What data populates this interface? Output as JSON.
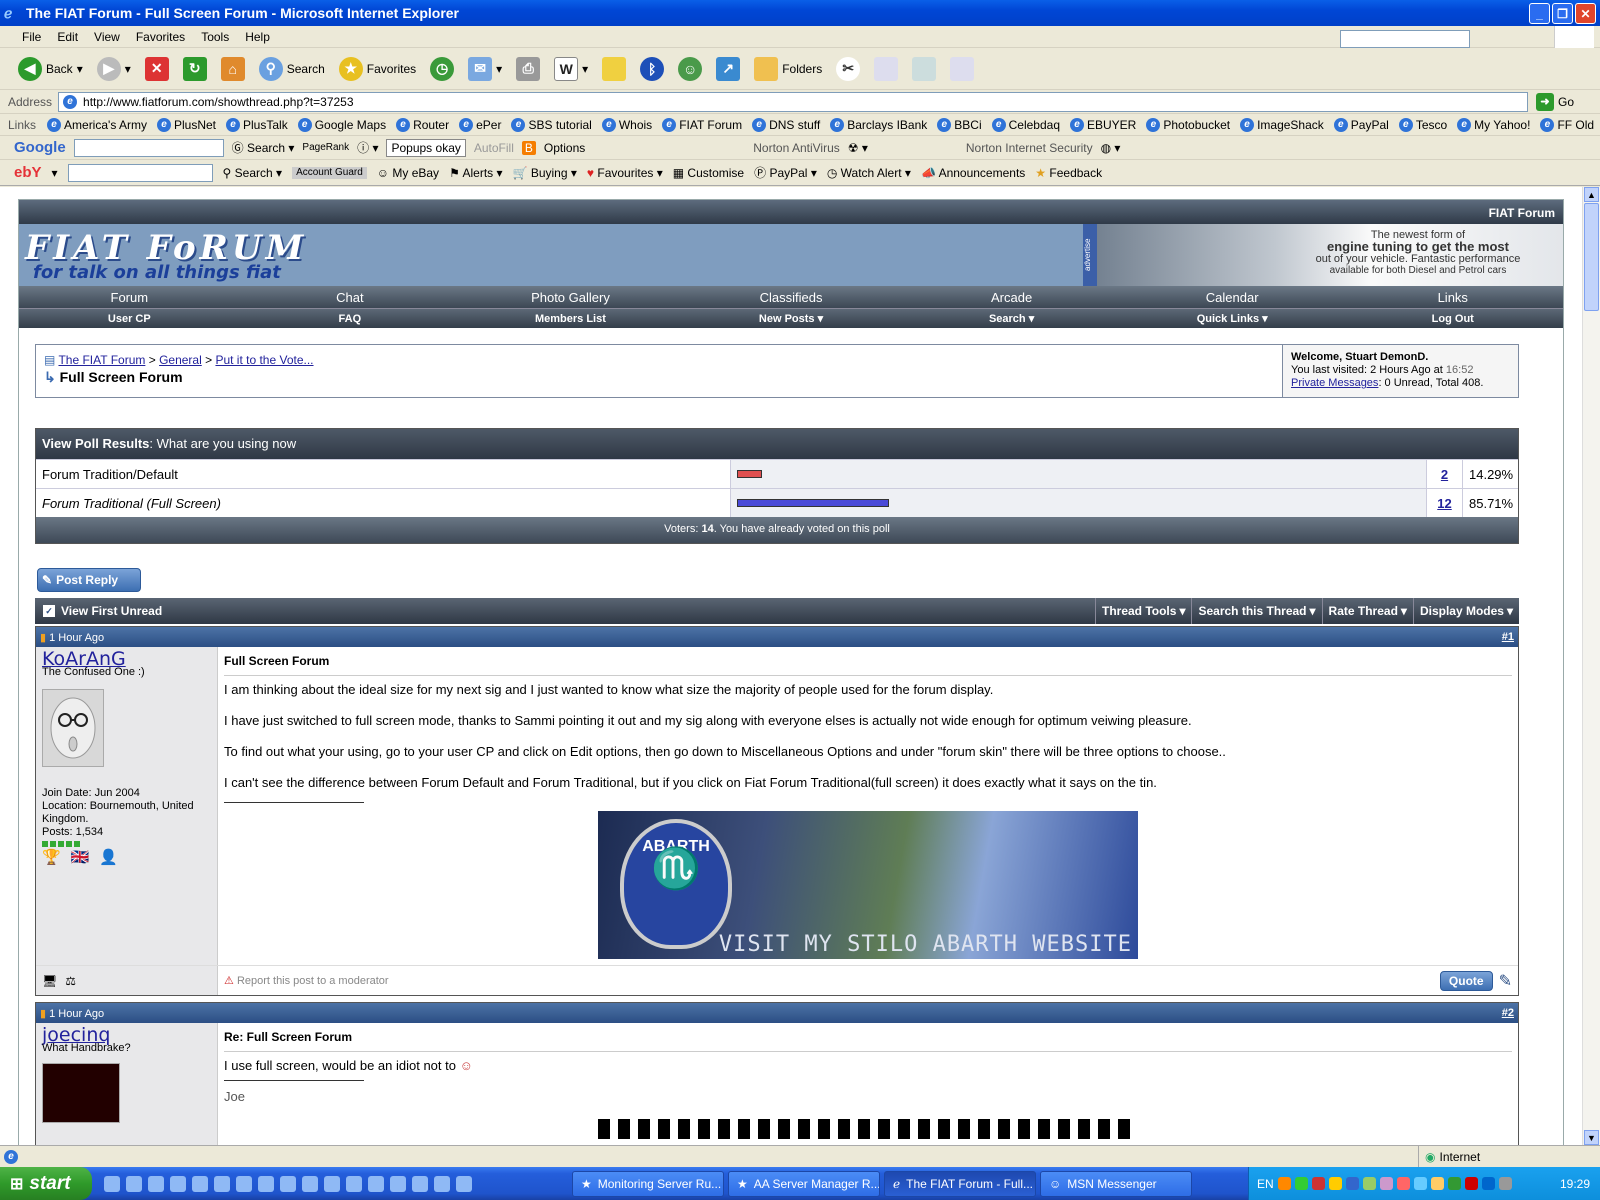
{
  "window": {
    "title": "The FIAT Forum - Full Screen Forum - Microsoft Internet Explorer"
  },
  "menu": [
    "File",
    "Edit",
    "View",
    "Favorites",
    "Tools",
    "Help"
  ],
  "toolbar": {
    "back": "Back",
    "search": "Search",
    "favorites": "Favorites",
    "folders": "Folders"
  },
  "address": {
    "label": "Address",
    "url": "http://www.fiatforum.com/showthread.php?t=37253",
    "go": "Go"
  },
  "links": {
    "label": "Links",
    "items": [
      "America's Army",
      "PlusNet",
      "PlusTalk",
      "Google Maps",
      "Router",
      "ePer",
      "SBS tutorial",
      "Whois",
      "FIAT Forum",
      "DNS stuff",
      "Barclays IBank",
      "BBCi",
      "Celebdaq",
      "EBUYER",
      "Photobucket",
      "ImageShack",
      "PayPal",
      "Tesco",
      "My Yahoo!",
      "FF Old"
    ]
  },
  "googlebar": {
    "brand": "Google",
    "search": "Search",
    "pagerank": "PageRank",
    "popups": "Popups okay",
    "autofill": "AutoFill",
    "options": "Options",
    "norton_av": "Norton AntiVirus",
    "norton_is": "Norton Internet Security"
  },
  "ebaybar": {
    "brand": "ebY",
    "search": "Search",
    "account_guard": "Account Guard",
    "my_ebay": "My eBay",
    "alerts": "Alerts",
    "buying": "Buying",
    "favourites": "Favourites",
    "customise": "Customise",
    "paypal": "PayPal",
    "watch_alert": "Watch Alert",
    "announcements": "Announcements",
    "feedback": "Feedback"
  },
  "site": {
    "top_label": "FIAT Forum",
    "logo": "FIAT FoRUM",
    "tagline": "for talk on all things fiat",
    "ad": {
      "side": "advertise",
      "line1": "The newest form of",
      "line2": "engine tuning to get the most",
      "line3": "out of your vehicle.  Fantastic performance",
      "line4": "available for both Diesel and Petrol cars"
    },
    "nav_primary": [
      "Forum",
      "Chat",
      "Photo Gallery",
      "Classifieds",
      "Arcade",
      "Calendar",
      "Links"
    ],
    "nav_secondary": [
      "User CP",
      "FAQ",
      "Members List",
      "New Posts ▾",
      "Search ▾",
      "Quick Links ▾",
      "Log Out"
    ]
  },
  "breadcrumb": {
    "crumbs": [
      "The FIAT Forum",
      "General",
      "Put it to the Vote..."
    ],
    "current": "Full Screen Forum",
    "welcome": "Welcome, Stuart DemonD.",
    "last_visited_label": "You last visited: 2 Hours Ago at",
    "last_visited_time": "16:52",
    "pm_label": "Private Messages",
    "pm_text": ": 0 Unread, Total 408."
  },
  "poll": {
    "title": "View Poll Results",
    "question": ": What are you using now",
    "options": [
      {
        "label": "Forum Tradition/Default",
        "votes": "2",
        "percent": "14.29%",
        "share": 14.29,
        "color": "#e05050"
      },
      {
        "label": "Forum Traditional (Full Screen)",
        "votes": "12",
        "percent": "85.71%",
        "share": 85.71,
        "color": "#4a4ad8"
      }
    ],
    "footer_label": "Voters:",
    "footer_count": "14",
    "footer_text": ". You have already voted on this poll"
  },
  "thread": {
    "post_reply": "Post Reply",
    "view_first_unread": "View First Unread",
    "tools": [
      "Thread Tools",
      "Search this Thread",
      "Rate Thread",
      "Display Modes"
    ]
  },
  "posts": [
    {
      "time": "1 Hour Ago",
      "num": "#1",
      "user": "KoArAnG",
      "title": "The Confused One :)",
      "join": "Join Date: Jun 2004",
      "location": "Location: Bournemouth, United Kingdom.",
      "posts": "Posts: 1,534",
      "subject": "Full Screen Forum",
      "paragraphs": [
        "I am thinking about the ideal size for my next sig and I just wanted to know what size the majority of people used for the forum display.",
        "I have just switched to full screen mode, thanks to Sammi pointing it out and my sig along with everyone elses is actually not wide enough for optimum veiwing pleasure.",
        "To find out what your using, go to your user CP and click on Edit options, then go down to Miscellaneous Options and under \"forum skin\" there will be three options to choose..",
        "I can't see the difference between Forum Default and Forum Traditional, but if you click on Fiat Forum Traditional(full screen) it does exactly what it says on the tin."
      ],
      "sig_badge": "ABARTH",
      "sig_text": "VISIT MY STILO ABARTH WEBSITE",
      "report": "Report this post to a moderator",
      "quote": "Quote"
    },
    {
      "time": "1 Hour Ago",
      "num": "#2",
      "user": "joecinq",
      "title": "What Handbrake?",
      "subject": "Re: Full Screen Forum",
      "body": "I use full screen, would be an idiot not to",
      "sig": "Joe"
    }
  ],
  "status": {
    "zone": "Internet"
  },
  "taskbar": {
    "start": "start",
    "tasks": [
      "Monitoring Server Ru...",
      "AA Server Manager R...",
      "The FIAT Forum - Full...",
      "MSN Messenger"
    ],
    "lang": "EN",
    "clock": "19:29"
  }
}
